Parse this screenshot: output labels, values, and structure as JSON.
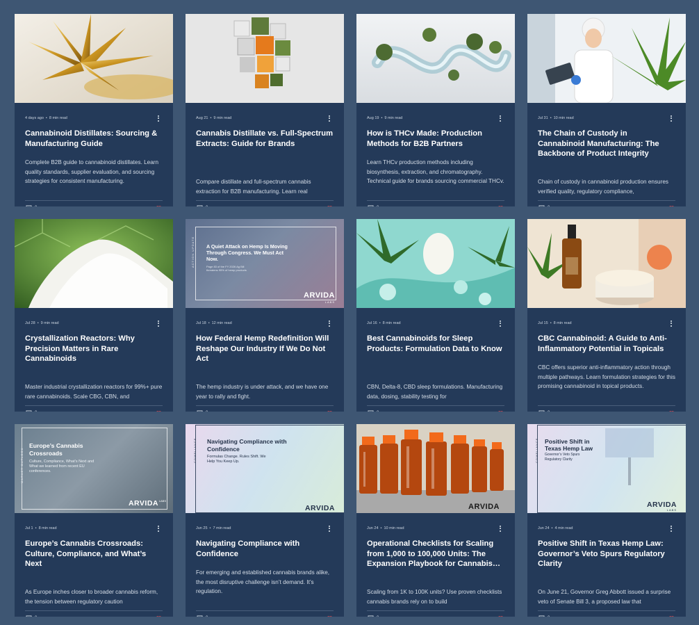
{
  "posts": [
    {
      "date": "4 days ago",
      "read_time": "8 min read",
      "title": "Cannabinoid Distillates: Sourcing & Manufacturing Guide",
      "excerpt": "Complete B2B guide to cannabinoid distillates. Learn quality standards, supplier evaluation, and sourcing strategies for consistent manufacturing.",
      "comments": "0",
      "excerpt_pos": "e3"
    },
    {
      "date": "Aug 21",
      "read_time": "9 min read",
      "title": "Cannabis Distillate vs. Full-Spectrum Extracts: Guide for Brands",
      "excerpt": "Compare distillate and full-spectrum cannabis extraction for B2B manufacturing. Learn real",
      "comments": "0",
      "excerpt_pos": "e2"
    },
    {
      "date": "Aug 19",
      "read_time": "9 min read",
      "title": "How is THCv Made: Production Methods for B2B Partners",
      "excerpt": "Learn THCv production methods including biosynthesis, extraction, and chromatography. Technical guide for brands sourcing commercial THCv.",
      "comments": "0",
      "excerpt_pos": "e3"
    },
    {
      "date": "Jul 31",
      "read_time": "10 min read",
      "title": "The Chain of Custody in Cannabinoid Manufacturing: The Backbone of Product Integrity",
      "excerpt": "Chain of custody in cannabinoid production ensures verified quality, regulatory compliance,",
      "comments": "0",
      "excerpt_pos": "e2"
    },
    {
      "date": "Jul 28",
      "read_time": "9 min read",
      "title": "Crystallization Reactors: Why Precision Matters in Rare Cannabinoids",
      "excerpt": "Master industrial crystallization reactors for 99%+ pure rare cannabinoids. Scale CBG, CBN, and",
      "comments": "0",
      "excerpt_pos": "e2"
    },
    {
      "date": "Jul 18",
      "read_time": "12 min read",
      "title": "How Federal Hemp Redefinition Will Reshape Our Industry If We Do Not Act",
      "excerpt": "The hemp industry is under attack, and we have one year to rally and fight.",
      "comments": "0",
      "excerpt_pos": "e2"
    },
    {
      "date": "Jul 16",
      "read_time": "8 min read",
      "title": "Best Cannabinoids for Sleep Products: Formulation Data to Know",
      "excerpt": "CBN, Delta-8, CBD sleep formulations. Manufacturing data, dosing, stability testing for",
      "comments": "0",
      "excerpt_pos": "e2"
    },
    {
      "date": "Jul 15",
      "read_time": "8 min read",
      "title": "CBC Cannabinoid: A Guide to Anti-Inflammatory Potential in Topicals",
      "excerpt": "CBC offers superior anti-inflammatory action through multiple pathways. Learn formulation strategies for this promising cannabinoid in topical products.",
      "comments": "0",
      "excerpt_pos": "e3"
    },
    {
      "date": "Jul 1",
      "read_time": "8 min read",
      "title": "Europe’s Cannabis Crossroads: Culture, Compliance, and What’s Next",
      "excerpt": "As Europe inches closer to broader cannabis reform, the tension between regulatory caution",
      "comments": "0",
      "excerpt_pos": "e2"
    },
    {
      "date": "Jun 25",
      "read_time": "7 min read",
      "title": "Navigating Compliance with Confidence",
      "excerpt": "For emerging and established cannabis brands alike, the most disruptive challenge isn’t demand. It’s regulation.",
      "comments": "0",
      "excerpt_pos": "e3"
    },
    {
      "date": "Jun 24",
      "read_time": "10 min read",
      "title": "Operational Checklists for Scaling from 1,000 to 100,000 Units: The Expansion Playbook for Cannabis Brands",
      "excerpt": "Scaling from 1K to 100K units? Use proven checklists cannabis brands rely on to build",
      "comments": "0",
      "excerpt_pos": "e2"
    },
    {
      "date": "Jun 24",
      "read_time": "4 min read",
      "title": "Positive Shift in Texas Hemp Law: Governor’s Veto Spurs Regulatory Clarity",
      "excerpt": "On June 21, Governor Greg Abbott issued a surprise veto of Senate Bill 3, a proposed law that",
      "comments": "0",
      "excerpt_pos": "e2"
    }
  ],
  "thumb_text": {
    "t6_tag": "ACTION UPDATE",
    "t6_head": "A Quiet Attack on Hemp Is Moving Through Congress. We Must Act Now.",
    "t6_sub": "Page 83 of the FY 2026 Ag Bill threatens 95% of hemp products",
    "t9_tag": "MARKET OUTLOOK",
    "t9_head": "Europe’s Cannabis Crossroads",
    "t9_sub": "Culture, Compliance, What’s Next and What we learned from recent EU conferences.",
    "t10_tag": "COMPLIANCE",
    "t10_head": "Navigating Compliance with Confidence",
    "t10_sub": "Formulas Change. Rules Shift. We Help You Keep Up.",
    "t12_tag": "COMPLIANCE",
    "t12_head": "Positive Shift in Texas Hemp Law",
    "t12_sub": "Governor’s Veto Spurs Regulatory Clarity",
    "logo": "ARVIDA",
    "logo_sub": "LABS"
  },
  "icons": {
    "comment": "comment-icon",
    "heart": "heart-icon",
    "menu": "more-options-icon"
  },
  "colors": {
    "background": "#3e5673",
    "card": "#243a59",
    "heart": "#e0484d"
  }
}
